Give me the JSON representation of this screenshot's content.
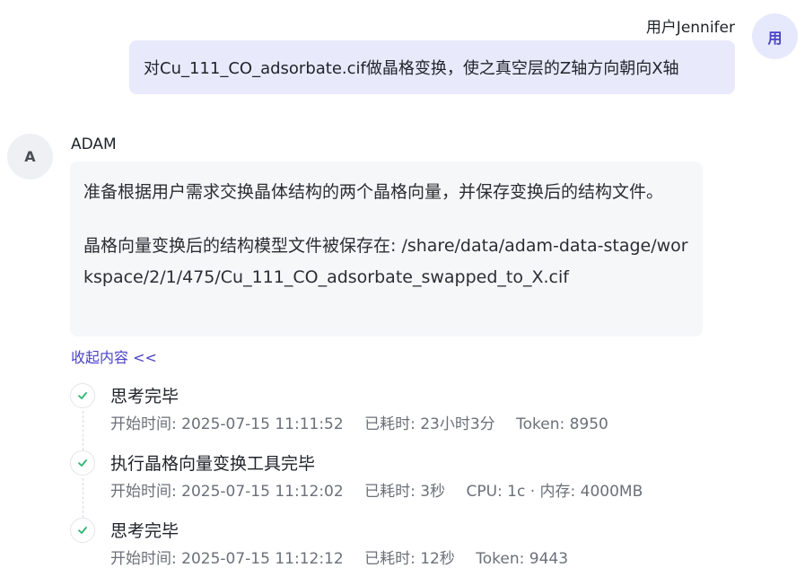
{
  "user": {
    "name": "用户Jennifer",
    "avatar_text": "用",
    "message": "对Cu_111_CO_adsorbate.cif做晶格变换，使之真空层的Z轴方向朝向X轴"
  },
  "assistant": {
    "avatar_text": "A",
    "name": "ADAM",
    "paragraph1": "准备根据用户需求交换晶体结构的两个晶格向量，并保存变换后的结构文件。",
    "paragraph2": "晶格向量变换后的结构模型文件被保存在: /share/data/adam-data-stage/workspace/2/1/475/Cu_111_CO_adsorbate_swapped_to_X.cif"
  },
  "collapse_label": "收起内容 <<",
  "steps": [
    {
      "title": "思考完毕",
      "start": "开始时间: 2025-07-15 11:11:52",
      "elapsed": "已耗时: 23小时3分",
      "extra": "Token: 8950",
      "status": "done"
    },
    {
      "title": "执行晶格向量变换工具完毕",
      "start": "开始时间: 2025-07-15 11:12:02",
      "elapsed": "已耗时: 3秒",
      "extra": "CPU: 1c · 内存: 4000MB",
      "status": "done"
    },
    {
      "title": "思考完毕",
      "start": "开始时间: 2025-07-15 11:12:12",
      "elapsed": "已耗时: 12秒",
      "extra": "Token: 9443",
      "status": "done"
    }
  ],
  "colors": {
    "accent": "#4b43c7",
    "success": "#2bb673",
    "user_bubble": "#e8eafc",
    "bot_bubble": "#f6f7f9"
  }
}
